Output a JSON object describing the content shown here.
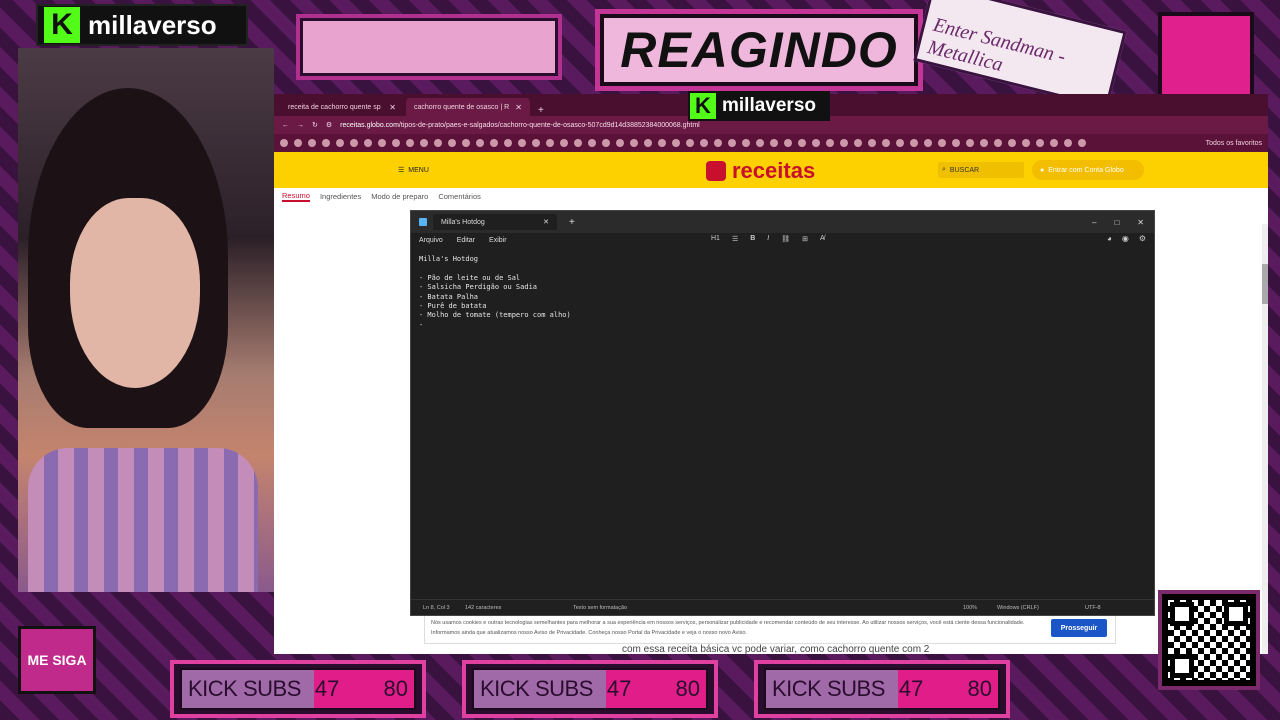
{
  "overlay": {
    "channel": "millaverso",
    "banner": "REAGINDO",
    "tape_label": "Enter Sandman - Metallica",
    "follow": "ME SIGA"
  },
  "browser": {
    "tabs": [
      "receita de cachorro quente sp",
      "cachorro quente de osasco | R"
    ],
    "url_domain": "receitas.globo.com",
    "url_path": "/tipos-de-prato/paes-e-salgados/cachorro-quente-de-osasco-507cd9d14d38852384000068.ghtml",
    "favorites": "Todos os favoritos"
  },
  "site": {
    "menu": "MENU",
    "brand": "receitas",
    "search": "BUSCAR",
    "login": "Entrar com Conta Globo",
    "subnav": [
      "Resumo",
      "Ingredientes",
      "Modo de preparo",
      "Comentários"
    ],
    "cookie_text": "Nós usamos cookies e outras tecnologias semelhantes para melhorar a sua experiência em nossos serviços, personalizar publicidade e recomendar conteúdo de seu interesse. Ao utilizar nossos serviços, você está ciente dessa funcionalidade. Informamos ainda que atualizamos nosso Aviso de Privacidade. Conheça nosso Portal da Privacidade e veja o nosso novo Aviso.",
    "cookie_button": "Prosseguir",
    "snippet": "com essa receita básica vc pode variar, como cachorro quente com 2"
  },
  "notepad": {
    "tab": "Milla's Hotdog",
    "menu": [
      "Arquivo",
      "Editar",
      "Exibir"
    ],
    "heading": "H1",
    "content": "Milla's Hotdog\n\n- Pão de leite ou de Sal\n- Salsicha Perdigão ou Sadia\n- Batata Palha\n- Purê de batata\n- Molho de tomate (tempero com alho)\n-",
    "status": {
      "position": "Ln 8, Col 3",
      "chars": "142 caracteres",
      "format": "Texto sem formatação",
      "zoom": "100%",
      "eol": "Windows (CRLF)",
      "encoding": "UTF-8"
    }
  },
  "subs": {
    "label": "KICK SUBS",
    "current": "47",
    "goal": "80"
  },
  "colors": {
    "accent": "#e01d88",
    "kick_green": "#53fc18",
    "globo_yellow": "#fdd000",
    "receitas_red": "#c8102e"
  }
}
